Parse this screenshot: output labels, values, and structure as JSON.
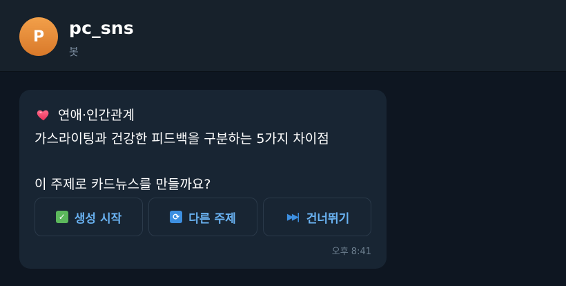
{
  "header": {
    "avatar_letter": "P",
    "name": "pc_sns",
    "subtitle": "봇"
  },
  "message": {
    "category": "연애·인간관계",
    "topic": "가스라이팅과 건강한 피드백을 구분하는 5가지 차이점",
    "question": "이 주제로 카드뉴스를 만들까요?",
    "time": "오후 8:41",
    "buttons": {
      "start": "생성 시작",
      "other_topic": "다른 주제",
      "skip": "건너뛰기"
    }
  },
  "icons": {
    "category": "heart-icon",
    "start": "check-icon",
    "other_topic": "refresh-icon",
    "skip": "skip-forward-icon"
  },
  "colors": {
    "background": "#0e1621",
    "header": "#17212b",
    "bubble": "#182533",
    "accent": "#6ab3f3",
    "avatar": "#e8893a"
  }
}
